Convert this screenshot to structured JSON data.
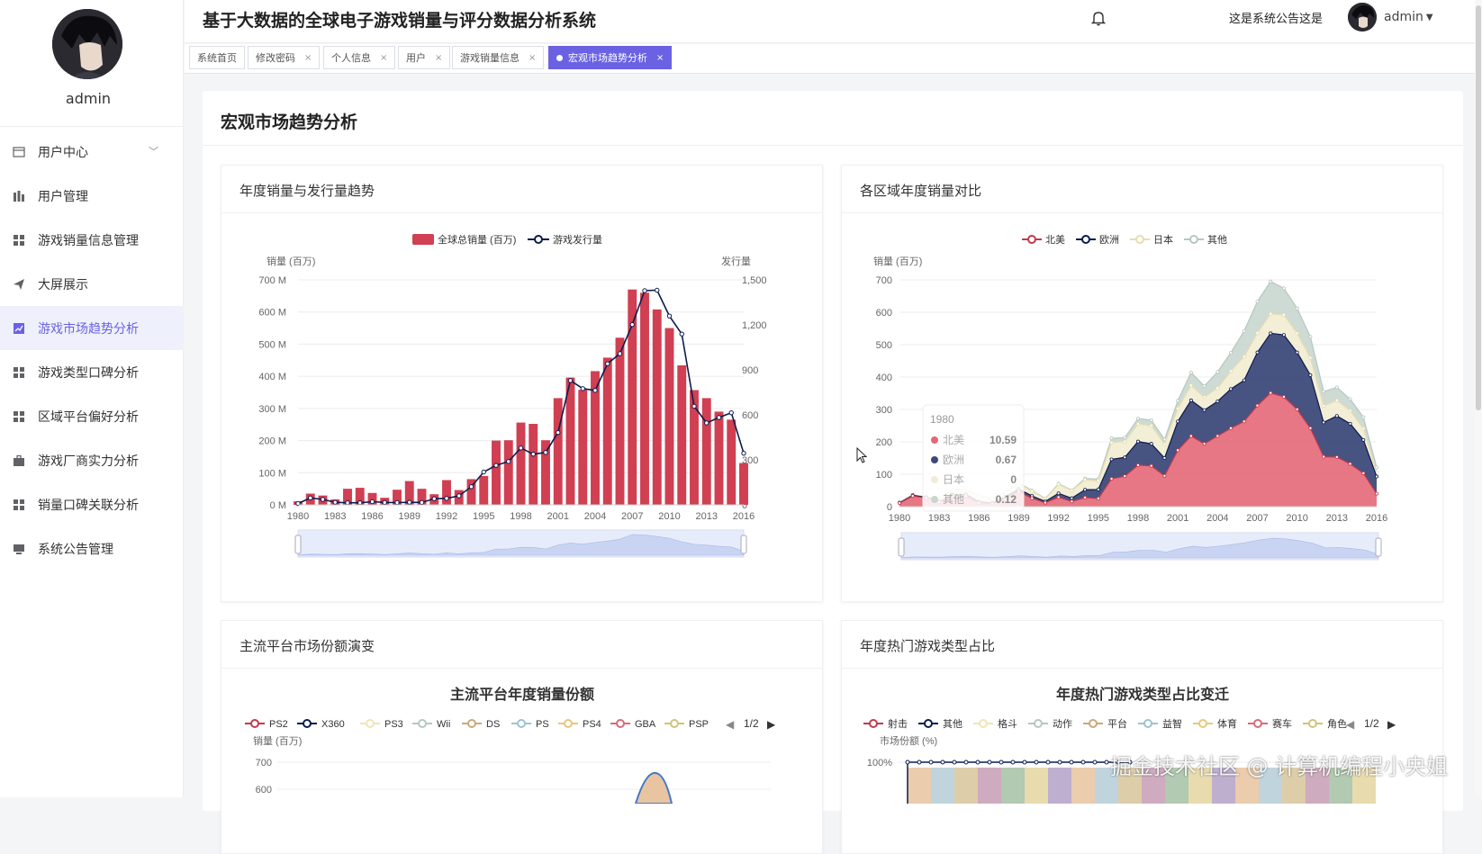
{
  "app": {
    "title": "基于大数据的全球电子游戏销量与评分数据分析系统",
    "notice": "这是系统公告这是",
    "user": "admin"
  },
  "sidebar": {
    "user": "admin",
    "items": [
      {
        "label": "用户中心",
        "icon": "user-center-icon"
      },
      {
        "label": "用户管理",
        "icon": "chart-bar-icon"
      },
      {
        "label": "游戏销量信息管理",
        "icon": "grid-icon"
      },
      {
        "label": "大屏展示",
        "icon": "send-icon"
      },
      {
        "label": "游戏市场趋势分析",
        "icon": "line-chart-icon"
      },
      {
        "label": "游戏类型口碑分析",
        "icon": "grid-icon"
      },
      {
        "label": "区域平台偏好分析",
        "icon": "grid-icon"
      },
      {
        "label": "游戏厂商实力分析",
        "icon": "briefcase-icon"
      },
      {
        "label": "销量口碑关联分析",
        "icon": "grid-icon"
      },
      {
        "label": "系统公告管理",
        "icon": "monitor-icon"
      }
    ]
  },
  "tabs": [
    "系统首页",
    "修改密码",
    "个人信息",
    "用户",
    "游戏销量信息",
    "宏观市场趋势分析"
  ],
  "main": {
    "title": "宏观市场趋势分析"
  },
  "cards": {
    "c1": "年度销量与发行量趋势",
    "c2": "各区域年度销量对比",
    "c3": "主流平台市场份额演变",
    "c4": "年度热门游戏类型占比"
  },
  "chart_data": [
    {
      "type": "bar",
      "legend": [
        "全球总销量 (百万)",
        "游戏发行量"
      ],
      "ylabel": "销量 (百万)",
      "y2label": "发行量",
      "ylim": [
        0,
        700
      ],
      "y2lim": [
        0,
        1500
      ],
      "yticks": [
        "0 M",
        "100 M",
        "200 M",
        "300 M",
        "400 M",
        "500 M",
        "600 M",
        "700 M"
      ],
      "y2ticks": [
        "0",
        "300",
        "600",
        "900",
        "1,200",
        "1,500"
      ],
      "xticks": [
        "1980",
        "1983",
        "1986",
        "1989",
        "1992",
        "1995",
        "1998",
        "2001",
        "2004",
        "2007",
        "2010",
        "2013",
        "2016"
      ],
      "categories": [
        1980,
        1981,
        1982,
        1983,
        1984,
        1985,
        1986,
        1987,
        1988,
        1989,
        1990,
        1991,
        1992,
        1993,
        1994,
        1995,
        1996,
        1997,
        1998,
        1999,
        2000,
        2001,
        2002,
        2003,
        2004,
        2005,
        2006,
        2007,
        2008,
        2009,
        2010,
        2011,
        2012,
        2013,
        2014,
        2015,
        2016
      ],
      "sales": [
        11,
        35,
        29,
        17,
        50,
        53,
        37,
        22,
        47,
        74,
        50,
        33,
        77,
        46,
        80,
        90,
        200,
        201,
        256,
        252,
        201,
        332,
        396,
        358,
        416,
        458,
        520,
        670,
        660,
        608,
        550,
        434,
        357,
        332,
        290,
        265,
        130
      ],
      "releases": [
        9,
        46,
        36,
        17,
        14,
        14,
        21,
        16,
        15,
        17,
        16,
        41,
        43,
        60,
        121,
        219,
        263,
        289,
        379,
        338,
        349,
        482,
        829,
        775,
        763,
        941,
        1008,
        1202,
        1428,
        1431,
        1259,
        1139,
        657,
        546,
        582,
        614,
        344
      ]
    },
    {
      "type": "area",
      "legend": [
        "北美",
        "欧洲",
        "日本",
        "其他"
      ],
      "ylabel": "销量 (百万)",
      "ylim": [
        0,
        700
      ],
      "yticks": [
        "0",
        "100",
        "200",
        "300",
        "400",
        "500",
        "600",
        "700"
      ],
      "xticks": [
        "1980",
        "1983",
        "1986",
        "1989",
        "1992",
        "1995",
        "1998",
        "2001",
        "2004",
        "2007",
        "2010",
        "2013",
        "2016"
      ],
      "tooltip": {
        "year": "1980",
        "rows": [
          {
            "name": "北美",
            "value": "10.59"
          },
          {
            "name": "欧洲",
            "value": "0.67"
          },
          {
            "name": "日本",
            "value": "0"
          },
          {
            "name": "其他",
            "value": "0.12"
          }
        ]
      },
      "series": [
        {
          "name": "北美",
          "values": [
            11,
            33,
            27,
            15,
            34,
            33,
            12,
            9,
            23,
            46,
            26,
            12,
            29,
            16,
            28,
            25,
            86,
            94,
            128,
            126,
            95,
            174,
            218,
            194,
            218,
            242,
            263,
            312,
            351,
            339,
            300,
            242,
            154,
            153,
            132,
            103,
            40
          ]
        },
        {
          "name": "欧洲",
          "values": [
            1,
            2,
            2,
            1,
            3,
            5,
            3,
            2,
            7,
            8,
            7,
            4,
            12,
            10,
            24,
            28,
            60,
            58,
            73,
            68,
            55,
            89,
            110,
            104,
            107,
            121,
            127,
            164,
            184,
            191,
            176,
            164,
            106,
            127,
            124,
            103,
            53
          ]
        },
        {
          "name": "日本",
          "values": [
            0,
            0,
            0,
            8,
            14,
            14,
            19,
            12,
            15,
            17,
            15,
            8,
            28,
            24,
            31,
            26,
            52,
            49,
            54,
            56,
            43,
            40,
            46,
            40,
            41,
            55,
            73,
            60,
            60,
            62,
            59,
            53,
            51,
            48,
            40,
            35,
            13
          ]
        },
        {
          "name": "其他",
          "values": [
            0,
            1,
            1,
            1,
            1,
            1,
            1,
            1,
            1,
            2,
            2,
            1,
            2,
            1,
            4,
            6,
            13,
            12,
            17,
            17,
            14,
            24,
            40,
            34,
            50,
            57,
            79,
            97,
            100,
            82,
            77,
            65,
            44,
            40,
            36,
            35,
            15
          ]
        }
      ]
    },
    {
      "type": "area",
      "title": "主流平台年度销量份额",
      "legend": [
        "PS2",
        "X360",
        "PS3",
        "Wii",
        "DS",
        "PS",
        "PS4",
        "GBA",
        "PSP"
      ],
      "legend_page": "1/2",
      "ylabel": "销量 (百万)",
      "yticks": [
        "700",
        "600"
      ]
    },
    {
      "type": "area",
      "title": "年度热门游戏类型占比变迁",
      "legend": [
        "射击",
        "其他",
        "格斗",
        "动作",
        "平台",
        "益智",
        "体育",
        "赛车",
        "角色"
      ],
      "legend_page": "1/2",
      "ylabel": "市场份额 (%)",
      "yticks": [
        "100%"
      ]
    }
  ],
  "colors": {
    "accent": "#6a62e3",
    "bar": "#d03f52",
    "na": "#e46877",
    "eu": "#3d4a7a",
    "jp": "#f2ecd2",
    "other": "#c9d6cf"
  },
  "watermark": "掘金技术社区 @ 计算机编程小央姐"
}
